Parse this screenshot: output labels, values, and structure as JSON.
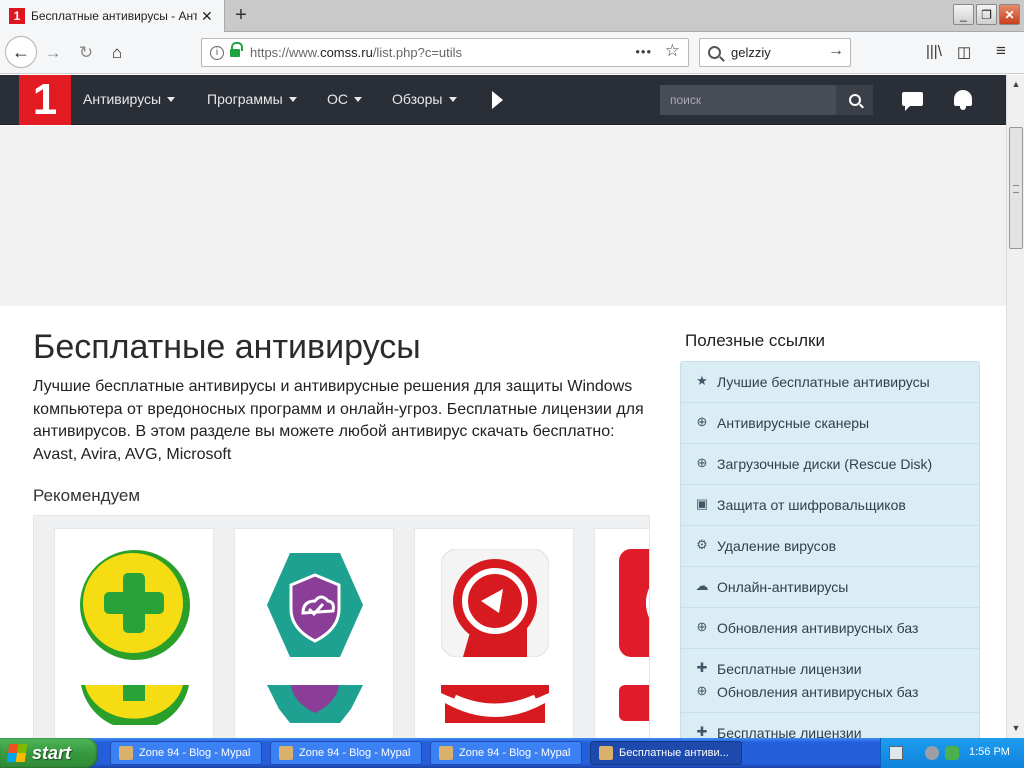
{
  "browser": {
    "tab_title": "Бесплатные антивирусы - Антивирусы",
    "tab_favicon": "1",
    "new_tab": "+",
    "url": {
      "prefix": "https://www.",
      "host": "comss.ru",
      "path": "/list.php?c=utils"
    },
    "search_value": "gelzziy"
  },
  "site": {
    "logo": "1",
    "menu": [
      {
        "label": "Антивирусы"
      },
      {
        "label": "Программы"
      },
      {
        "label": "ОС"
      },
      {
        "label": "Обзоры"
      }
    ],
    "search_placeholder": "поиск"
  },
  "main": {
    "title": "Бесплатные антивирусы",
    "description": "Лучшие бесплатные антивирусы и антивирусные решения для защиты Windows компьютера от вредоносных программ и онлайн-угроз. Бесплатные лицензии для антивирусов. В этом разделе вы можете любой антивирус скачать бесплатно: Avast, Avira, AVG, Microsoft",
    "recommend_title": "Рекомендуем"
  },
  "sidebar": {
    "title": "Полезные ссылки",
    "links": [
      {
        "icon": "★",
        "label": "Лучшие бесплатные антивирусы"
      },
      {
        "icon": "⊕",
        "label": "Антивирусные сканеры"
      },
      {
        "icon": "⊕",
        "label": "Загрузочные диски (Rescue Disk)"
      },
      {
        "icon": "▣",
        "label": "Защита от шифровальщиков"
      },
      {
        "icon": "⚙",
        "label": "Удаление вирусов"
      },
      {
        "icon": "☁",
        "label": "Онлайн-антивирусы"
      },
      {
        "icon": "⊕",
        "label": "Обновления антивирусных баз"
      },
      {
        "icon": "✚",
        "label": "Бесплатные лицензии"
      },
      {
        "icon": "⊕",
        "label": "Обновления антивирусных баз"
      },
      {
        "icon": "✚",
        "label": "Бесплатные лицензии"
      }
    ]
  },
  "taskbar": {
    "start": "start",
    "tasks": [
      {
        "label": "Zone 94 - Blog - Mypal"
      },
      {
        "label": "Zone 94 - Blog - Mypal"
      },
      {
        "label": "Zone 94 - Blog - Mypal"
      },
      {
        "label": "Бесплатные антиви..."
      }
    ],
    "clock": "1:56 PM"
  },
  "colors": {
    "site_header": "#2a2e36",
    "brand_red": "#e21b22",
    "sidebar_bg": "#daedf4"
  }
}
